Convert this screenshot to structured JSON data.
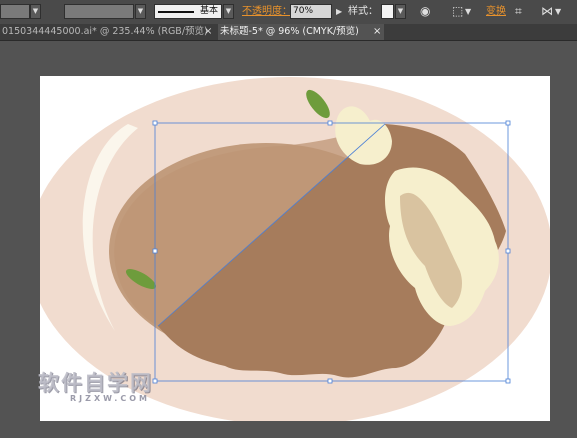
{
  "control_bar": {
    "stroke_profile_label": "基本",
    "opacity_label": "不透明度：",
    "opacity_value": "70%",
    "style_label": "样式：",
    "transform_label": "变换"
  },
  "tabs": [
    {
      "label": "0150344445000.ai* @ 235.44% (RGB/预览)",
      "active": false
    },
    {
      "label": "未标题-5* @ 96% (CMYK/预览)",
      "active": true
    }
  ],
  "watermark": {
    "main": "软件自学网",
    "sub": "RJZXW.COM"
  },
  "colors": {
    "plate_outer": "#f1dccf",
    "plate_inner": "#c29c7d",
    "slice": "#a67c5c",
    "cream": "#f6efcd",
    "leaf": "#6e9c3c",
    "selection": "#4a7fd6",
    "accent_orange": "#e8922c"
  }
}
